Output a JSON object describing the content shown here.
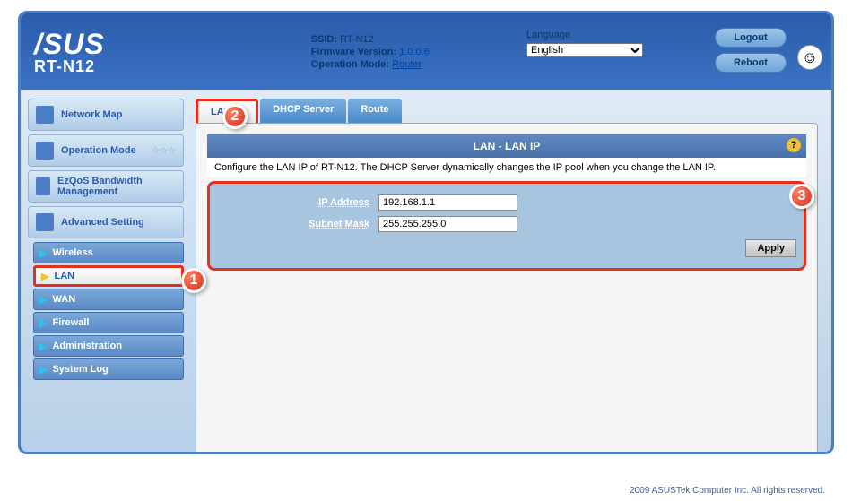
{
  "header": {
    "brand": "/SUS",
    "model": "RT-N12",
    "ssid_label": "SSID:",
    "ssid_value": "RT-N12",
    "firmware_label": "Firmware Version:",
    "firmware_value": "1.0.0.6",
    "mode_label": "Operation Mode:",
    "mode_value": "Router",
    "language_label": "Language",
    "language_value": "English",
    "logout": "Logout",
    "reboot": "Reboot"
  },
  "sidebar": {
    "main": [
      {
        "label": "Network Map"
      },
      {
        "label": "Operation Mode"
      },
      {
        "label": "EzQoS Bandwidth Management"
      },
      {
        "label": "Advanced Setting"
      }
    ],
    "sub": [
      {
        "label": "Wireless"
      },
      {
        "label": "LAN",
        "selected": true
      },
      {
        "label": "WAN"
      },
      {
        "label": "Firewall"
      },
      {
        "label": "Administration"
      },
      {
        "label": "System Log"
      }
    ]
  },
  "tabs": [
    {
      "label": "LAN IP",
      "active": true
    },
    {
      "label": "DHCP Server"
    },
    {
      "label": "Route"
    }
  ],
  "panel": {
    "title": "LAN - LAN IP",
    "description": "Configure the LAN IP of RT-N12. The DHCP Server dynamically changes the IP pool when you change the LAN IP.",
    "ip_label": "IP Address",
    "ip_value": "192.168.1.1",
    "mask_label": "Subnet Mask",
    "mask_value": "255.255.255.0",
    "apply": "Apply",
    "help": "?"
  },
  "badges": {
    "b1": "1",
    "b2": "2",
    "b3": "3"
  },
  "footer": "2009 ASUSTek Computer Inc. All rights reserved."
}
